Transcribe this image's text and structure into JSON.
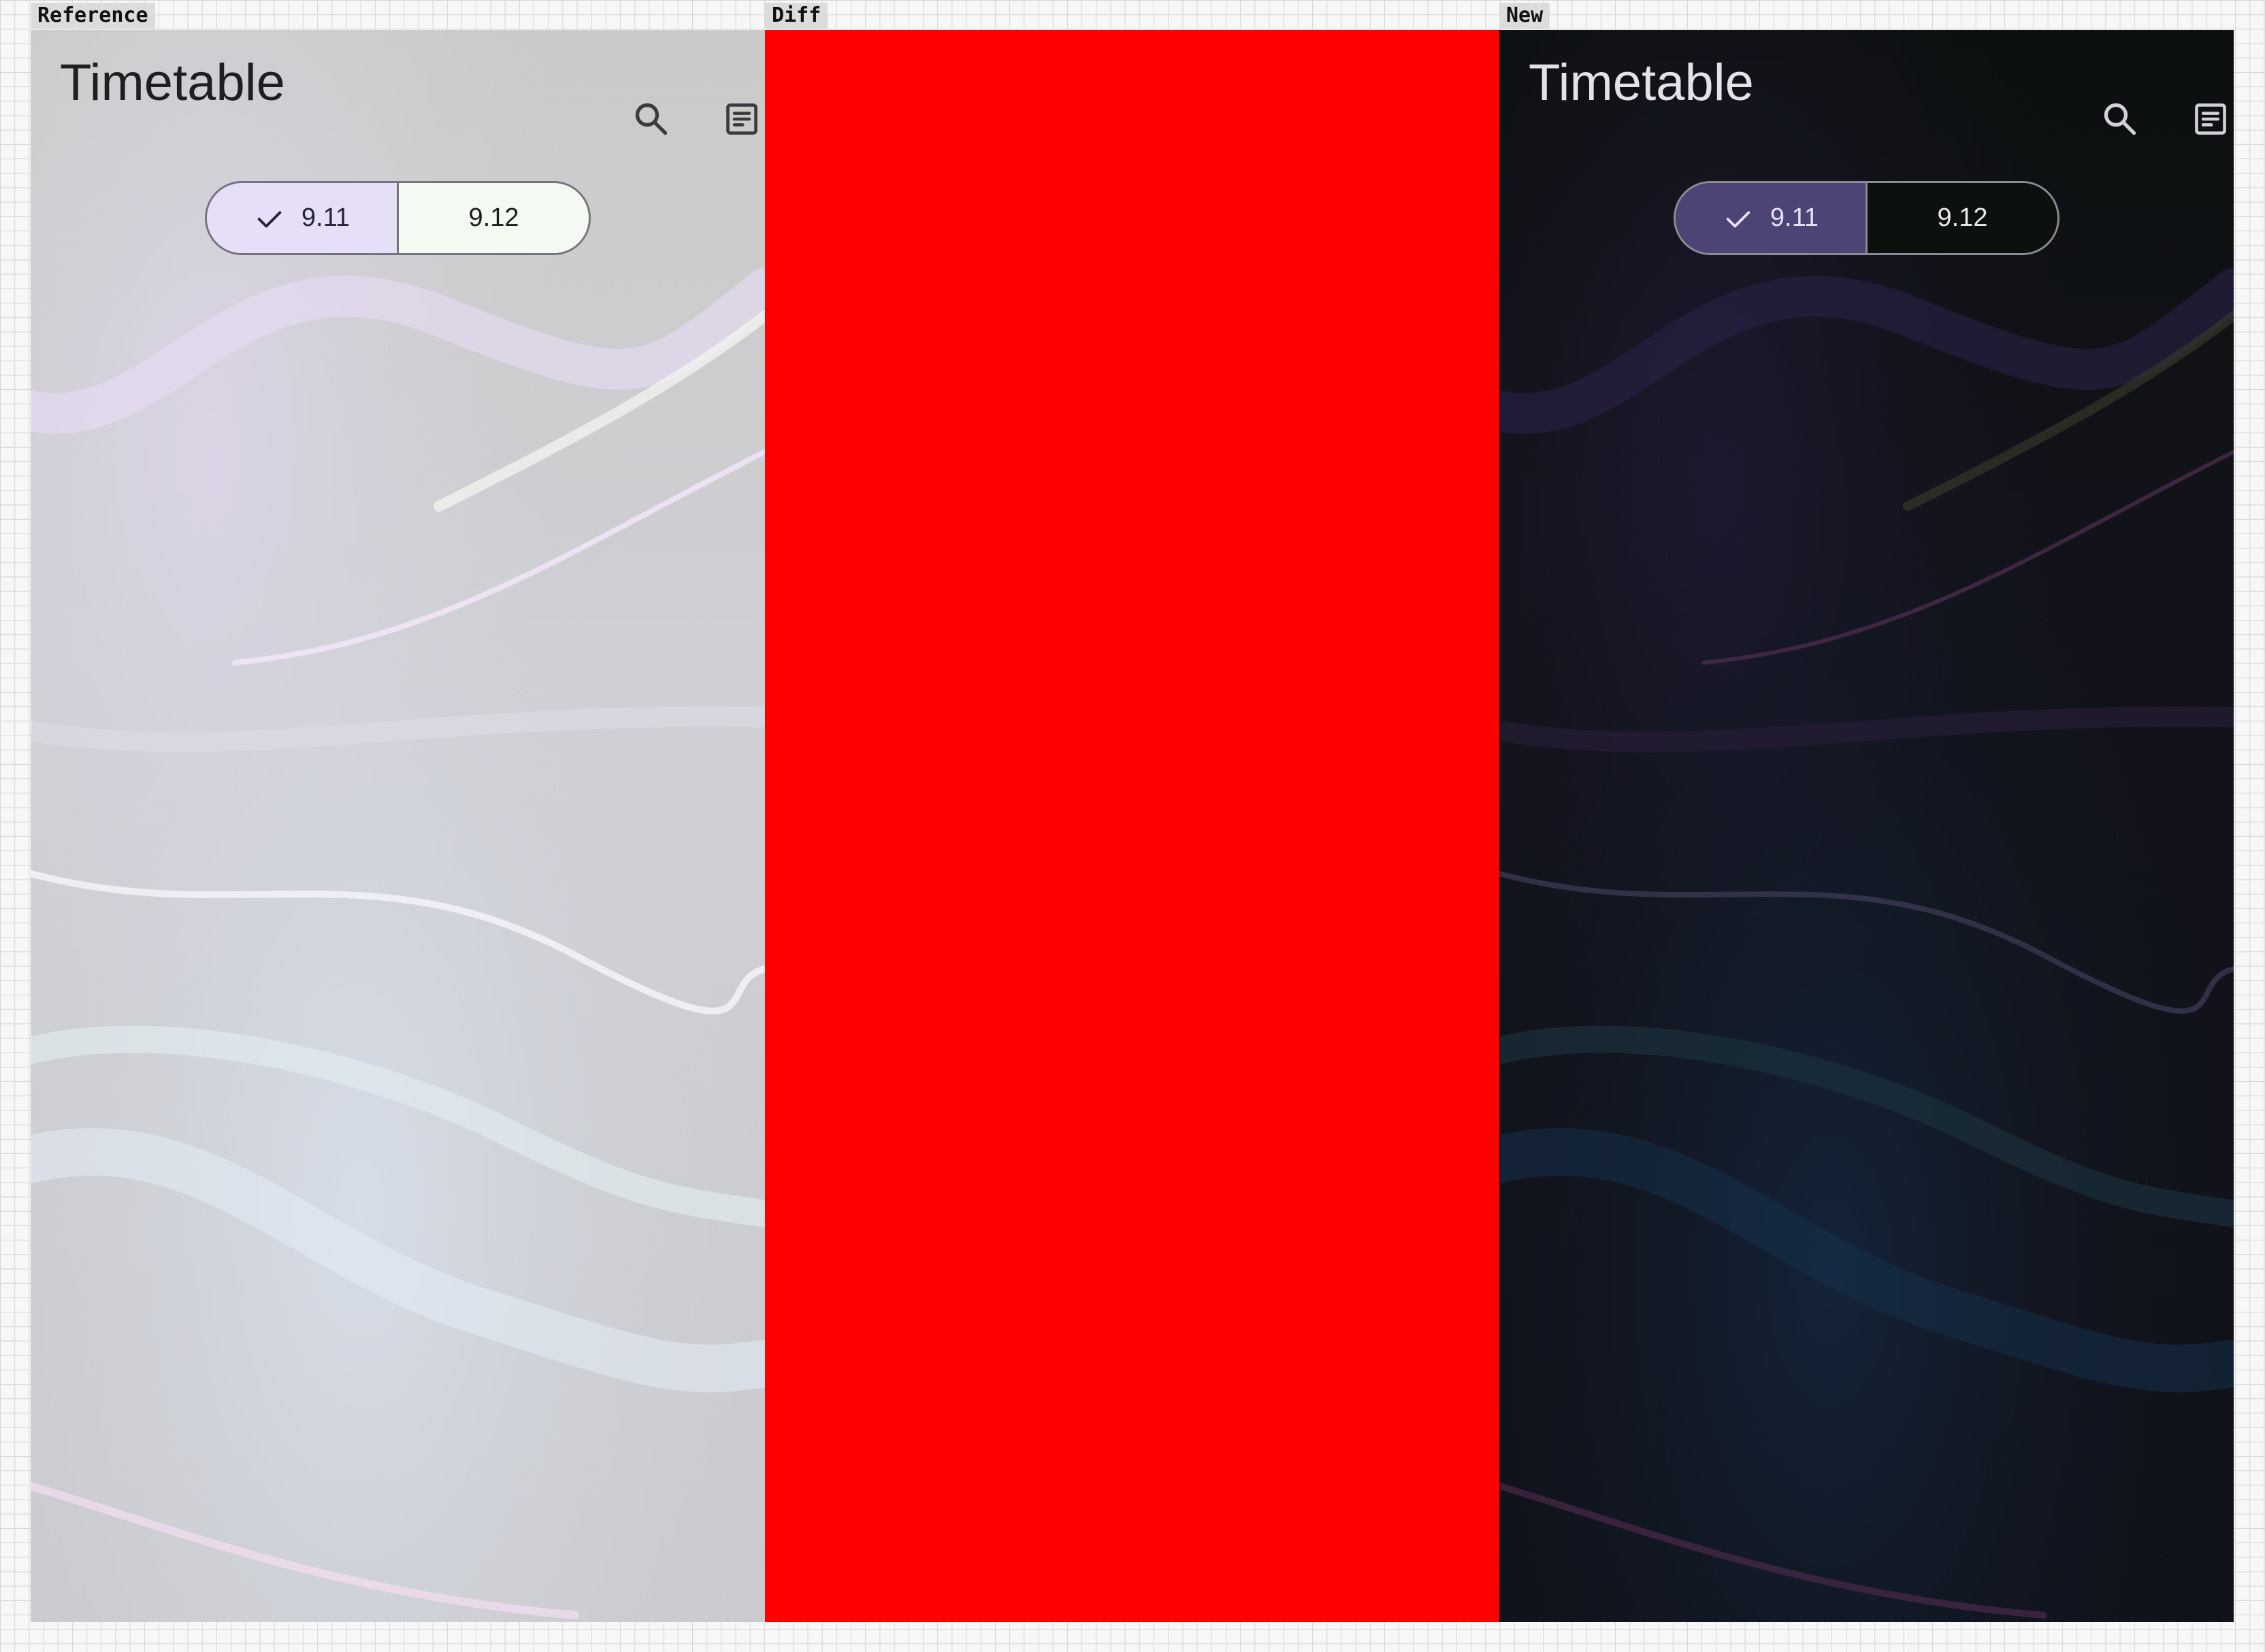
{
  "labels": {
    "reference": "Reference",
    "diff": "Diff",
    "new": "New"
  },
  "app": {
    "title": "Timetable",
    "search_icon": "search-icon",
    "notes_icon": "notes-icon",
    "days": [
      {
        "label": "9.11",
        "selected": true
      },
      {
        "label": "9.12",
        "selected": false
      }
    ]
  },
  "themes": {
    "light": {
      "background": "#cccdca",
      "title": "#1f1f23",
      "selected_segment": "#e7def8",
      "unselected_segment": "#f4f9f2"
    },
    "dark": {
      "background": "#0f1115",
      "title": "#e4e2e8",
      "selected_segment": "#4d4374",
      "unselected_segment": "#0d110e"
    },
    "diff": {
      "background": "#ff0000"
    }
  }
}
